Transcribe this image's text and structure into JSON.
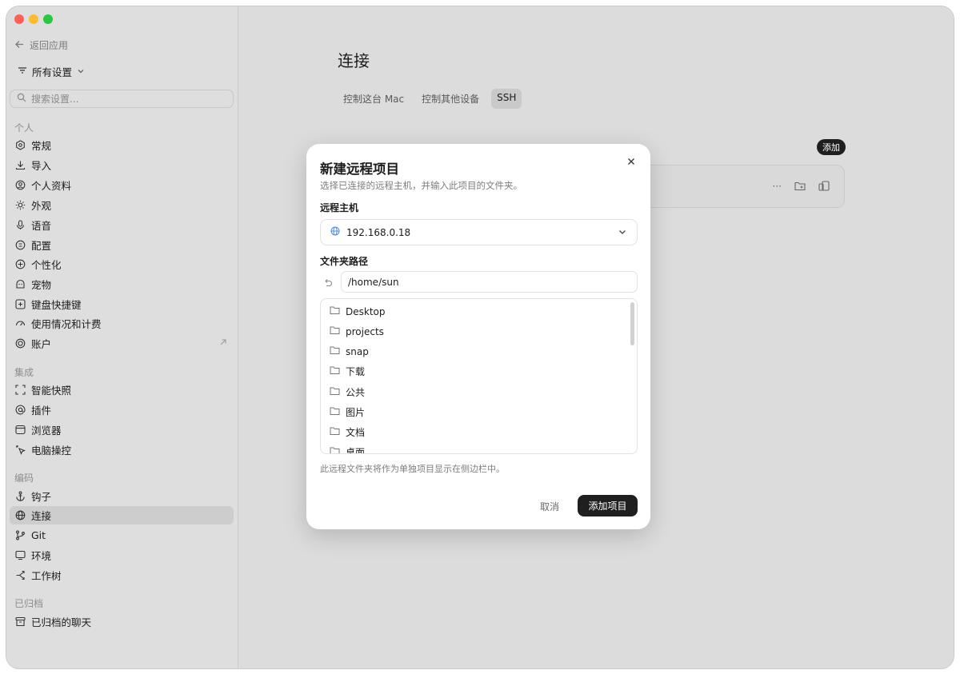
{
  "sidebar": {
    "back_label": "返回应用",
    "all_settings_label": "所有设置",
    "search_placeholder": "搜索设置...",
    "sections": {
      "personal": "个人",
      "integration": "集成",
      "coding": "编码",
      "archived": "已归档"
    },
    "items": {
      "general": "常规",
      "import": "导入",
      "profile": "个人资料",
      "appearance": "外观",
      "voice": "语音",
      "config": "配置",
      "personalize": "个性化",
      "pet": "宠物",
      "shortcuts": "键盘快捷键",
      "usage": "使用情况和计费",
      "account": "账户",
      "snapshot": "智能快照",
      "plugins": "插件",
      "browser": "浏览器",
      "computer_control": "电脑操控",
      "hooks": "钩子",
      "connection": "连接",
      "git": "Git",
      "environment": "环境",
      "worktree": "工作树",
      "archived_chats": "已归档的聊天"
    }
  },
  "main": {
    "title": "连接",
    "tabs": [
      "控制这台 Mac",
      "控制其他设备",
      "SSH"
    ],
    "selected_tab": "SSH",
    "add_chip": "添加"
  },
  "modal": {
    "title": "新建远程项目",
    "subtitle": "选择已连接的远程主机，并输入此项目的文件夹。",
    "host_label": "远程主机",
    "host_value": "192.168.0.18",
    "path_label": "文件夹路径",
    "path_value": "/home/sun",
    "folders": [
      "Desktop",
      "projects",
      "snap",
      "下载",
      "公共",
      "图片",
      "文档",
      "桌面"
    ],
    "note": "此远程文件夹将作为单独项目显示在侧边栏中。",
    "cancel_label": "取消",
    "submit_label": "添加项目"
  },
  "colors": {
    "close": "#fe5f57",
    "minimize": "#febc2e",
    "zoom": "#28c840",
    "primary_button": "#1f1f1f",
    "sidebar_bg": "#dedede",
    "content_bg": "#dcdcdc"
  }
}
